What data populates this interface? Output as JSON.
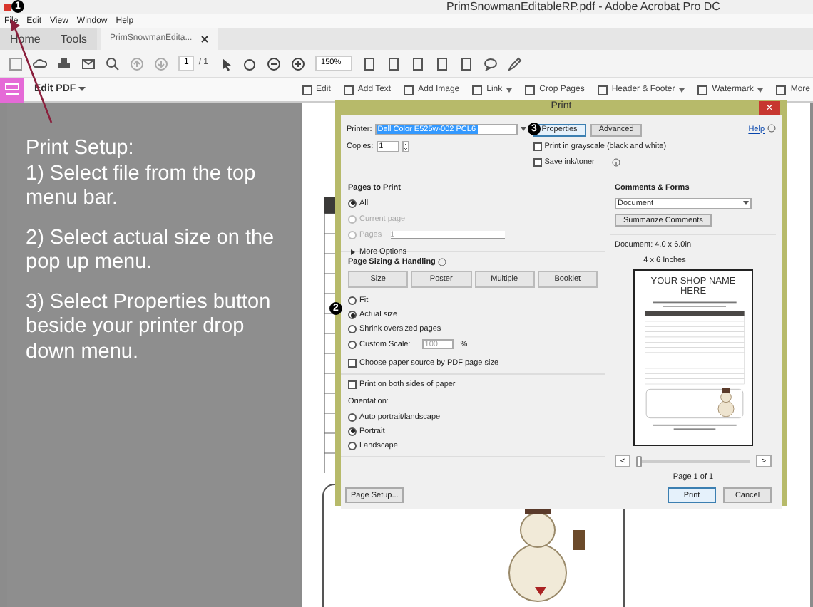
{
  "window": {
    "title": "PrimSnowmanEditableRP.pdf - Adobe Acrobat Pro DC"
  },
  "menu": [
    "File",
    "Edit",
    "View",
    "Window",
    "Help"
  ],
  "nav_tabs": [
    {
      "label": "Home",
      "selected": false
    },
    {
      "label": "Tools",
      "selected": false
    },
    {
      "label": "PrimSnowmanEdita...",
      "selected": true
    }
  ],
  "toolbar": {
    "page": "1",
    "page_count": "/ 1",
    "zoom": "150%"
  },
  "edit_bar": {
    "title": "Edit PDF",
    "tools": [
      {
        "label": "Edit",
        "dropdown": false
      },
      {
        "label": "Add Text",
        "dropdown": false
      },
      {
        "label": "Add Image",
        "dropdown": false
      },
      {
        "label": "Link",
        "dropdown": true
      },
      {
        "label": "Crop Pages",
        "dropdown": false
      },
      {
        "label": "Header & Footer",
        "dropdown": true
      },
      {
        "label": "Watermark",
        "dropdown": true
      },
      {
        "label": "More",
        "dropdown": false
      }
    ]
  },
  "instructions": {
    "heading": "Print Setup:",
    "steps": [
      "1) Select file from the top menu bar.",
      "2) Select actual size on the pop up menu.",
      "3) Select Properties button beside your printer drop down menu."
    ]
  },
  "step_badges": [
    "1",
    "2",
    "3"
  ],
  "print_dialog": {
    "title": "Print",
    "close": "×",
    "printer": {
      "label": "Printer:",
      "value": "Dell Color E525w-002 PCL6"
    },
    "properties_button": "Properties",
    "advanced_button": "Advanced",
    "help": "Help",
    "copies": {
      "label": "Copies:",
      "value": "1"
    },
    "print_options": [
      {
        "label": "Print in grayscale (black and white)",
        "checked": false
      },
      {
        "label": "Save ink/toner",
        "checked": false
      }
    ],
    "pages_to_print": {
      "title": "Pages to Print",
      "options": [
        {
          "label": "All",
          "selected": true,
          "disabled": false
        },
        {
          "label": "Current page",
          "selected": false,
          "disabled": true
        },
        {
          "label": "Pages",
          "selected": false,
          "disabled": true
        }
      ],
      "pages_value": "1",
      "more_options": "More Options"
    },
    "sizing": {
      "title": "Page Sizing & Handling",
      "modes": [
        "Size",
        "Poster",
        "Multiple",
        "Booklet"
      ],
      "options": [
        {
          "label": "Fit",
          "selected": false
        },
        {
          "label": "Actual size",
          "selected": true
        },
        {
          "label": "Shrink oversized pages",
          "selected": false
        },
        {
          "label": "Custom Scale:",
          "selected": false
        }
      ],
      "scale_value": "100",
      "scale_unit": "%",
      "paper_source": {
        "label": "Choose paper source by PDF page size",
        "checked": false
      }
    },
    "both_sides": {
      "label": "Print on both sides of paper",
      "checked": false
    },
    "orientation": {
      "title": "Orientation:",
      "options": [
        {
          "label": "Auto portrait/landscape",
          "selected": false
        },
        {
          "label": "Portrait",
          "selected": true
        },
        {
          "label": "Landscape",
          "selected": false
        }
      ]
    },
    "page_setup_button": "Page Setup...",
    "comments_forms": {
      "title": "Comments & Forms",
      "value": "Document",
      "summarize_button": "Summarize Comments"
    },
    "preview": {
      "document_size": "Document: 4.0 x 6.0in",
      "paper_size": "4 x 6 Inches",
      "shop_name": "YOUR SHOP NAME HERE",
      "prev": "<",
      "next": ">",
      "page_slider": {
        "level": 0
      },
      "page_label": "Page 1 of 1"
    },
    "print_button": "Print",
    "cancel_button": "Cancel"
  }
}
